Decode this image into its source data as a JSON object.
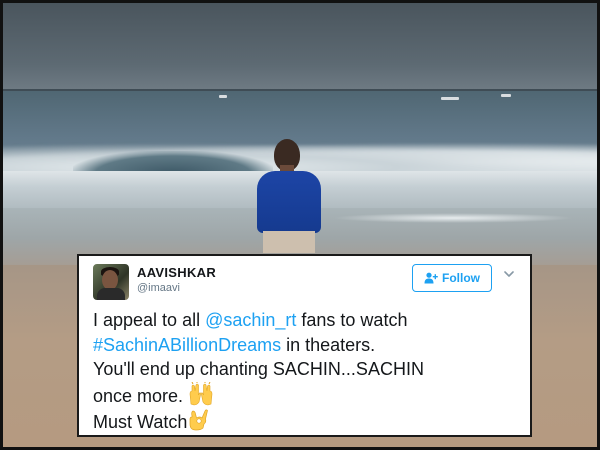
{
  "tweet": {
    "display_name": "AAVISHKAR",
    "handle": "@imaavi",
    "follow_label": "Follow",
    "lines": {
      "l1_pre": "I appeal to all ",
      "l1_mention": "@sachin_rt",
      "l1_post": " fans to watch",
      "l2_hashtag": "#SachinABillionDreams",
      "l2_post": " in theaters.",
      "l3": "You'll end up chanting SACHIN...SACHIN",
      "l4": "once more. ",
      "l5": "Must Watch"
    }
  },
  "colors": {
    "accent": "#1da1f2",
    "text": "#14171a",
    "muted": "#657786",
    "shirt": "#1d45a6"
  },
  "icons": {
    "follow": "person-add-icon",
    "menu": "chevron-down-icon",
    "emoji_1": "raised-hands-emoji-icon",
    "emoji_2": "ok-hand-emoji-icon"
  }
}
